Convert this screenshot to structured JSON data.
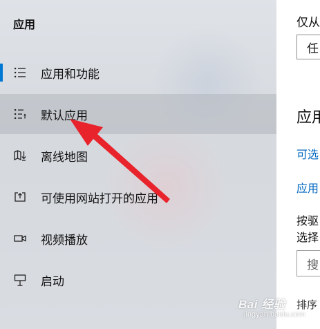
{
  "sidebar": {
    "title": "应用",
    "items": [
      {
        "label": "应用和功能",
        "icon": "list-icon"
      },
      {
        "label": "默认应用",
        "icon": "default-apps-icon"
      },
      {
        "label": "离线地图",
        "icon": "offline-map-icon"
      },
      {
        "label": "可使用网站打开的应用",
        "icon": "website-apps-icon"
      },
      {
        "label": "视频播放",
        "icon": "video-icon"
      },
      {
        "label": "启动",
        "icon": "startup-icon"
      }
    ],
    "selected_index": 1,
    "active_indicator_index": 0,
    "accent_color": "#0078d4"
  },
  "right_panel": {
    "heading_partial": "仅从",
    "dropdown_value": "任",
    "section_heading": "应用",
    "link1": "可选",
    "link2": "应用",
    "text_line1": "按驱",
    "text_line2": "选择",
    "search_placeholder": "搜",
    "sort_label": "排序"
  },
  "annotation": {
    "type": "red-arrow",
    "color": "#e8232b"
  },
  "watermark": {
    "main": "Bai 经验",
    "sub": "jingyan.baidu.com"
  }
}
